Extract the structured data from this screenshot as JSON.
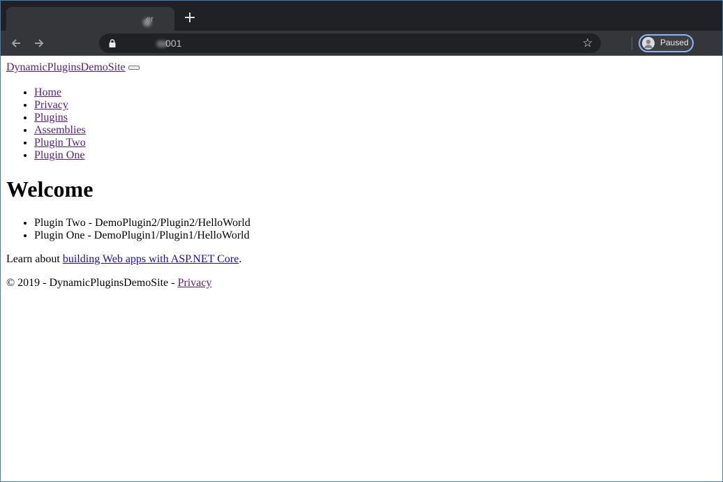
{
  "browser": {
    "tab_title": "er",
    "new_tab_symbol": "+",
    "url": "001",
    "profile_status": "Paused",
    "icons": {
      "back": "arrow-left-icon",
      "forward": "arrow-right-icon",
      "lock": "lock-icon",
      "bookmark": "star-icon",
      "profile": "avatar-icon"
    },
    "colors": {
      "tab_strip": "#202124",
      "toolbar": "#35363a",
      "profile_ring": "#8ab4f8"
    }
  },
  "site": {
    "brand": "DynamicPluginsDemoSite",
    "nav_items": [
      "Home",
      "Privacy",
      "Plugins",
      "Assemblies",
      "Plugin Two",
      "Plugin One"
    ],
    "heading": "Welcome",
    "plugins": [
      "Plugin Two - DemoPlugin2/Plugin2/HelloWorld",
      "Plugin One - DemoPlugin1/Plugin1/HelloWorld"
    ],
    "learn_prefix": "Learn about ",
    "learn_link": "building Web apps with ASP.NET Core",
    "learn_suffix": ".",
    "footer_text": "© 2019 - DynamicPluginsDemoSite - ",
    "footer_link": "Privacy",
    "colors": {
      "visited_link": "#551a8b",
      "link": "#1a0dab"
    }
  }
}
